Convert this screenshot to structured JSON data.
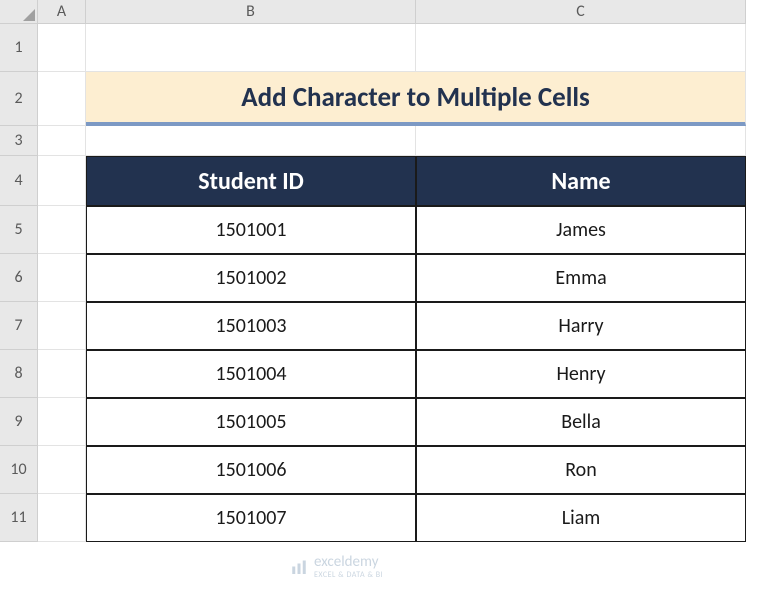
{
  "columns": [
    "A",
    "B",
    "C"
  ],
  "rows": [
    "1",
    "2",
    "3",
    "4",
    "5",
    "6",
    "7",
    "8",
    "9",
    "10",
    "11"
  ],
  "title": "Add Character to Multiple Cells",
  "headers": {
    "student_id": "Student ID",
    "name": "Name"
  },
  "data": [
    {
      "id": "1501001",
      "name": "James"
    },
    {
      "id": "1501002",
      "name": "Emma"
    },
    {
      "id": "1501003",
      "name": "Harry"
    },
    {
      "id": "1501004",
      "name": "Henry"
    },
    {
      "id": "1501005",
      "name": "Bella"
    },
    {
      "id": "1501006",
      "name": "Ron"
    },
    {
      "id": "1501007",
      "name": "Liam"
    }
  ],
  "watermark": {
    "brand": "exceldemy",
    "tagline": "EXCEL & DATA & BI"
  },
  "chart_data": {
    "type": "table",
    "title": "Add Character to Multiple Cells",
    "columns": [
      "Student ID",
      "Name"
    ],
    "rows": [
      [
        "1501001",
        "James"
      ],
      [
        "1501002",
        "Emma"
      ],
      [
        "1501003",
        "Harry"
      ],
      [
        "1501004",
        "Henry"
      ],
      [
        "1501005",
        "Bella"
      ],
      [
        "1501006",
        "Ron"
      ],
      [
        "1501007",
        "Liam"
      ]
    ]
  }
}
